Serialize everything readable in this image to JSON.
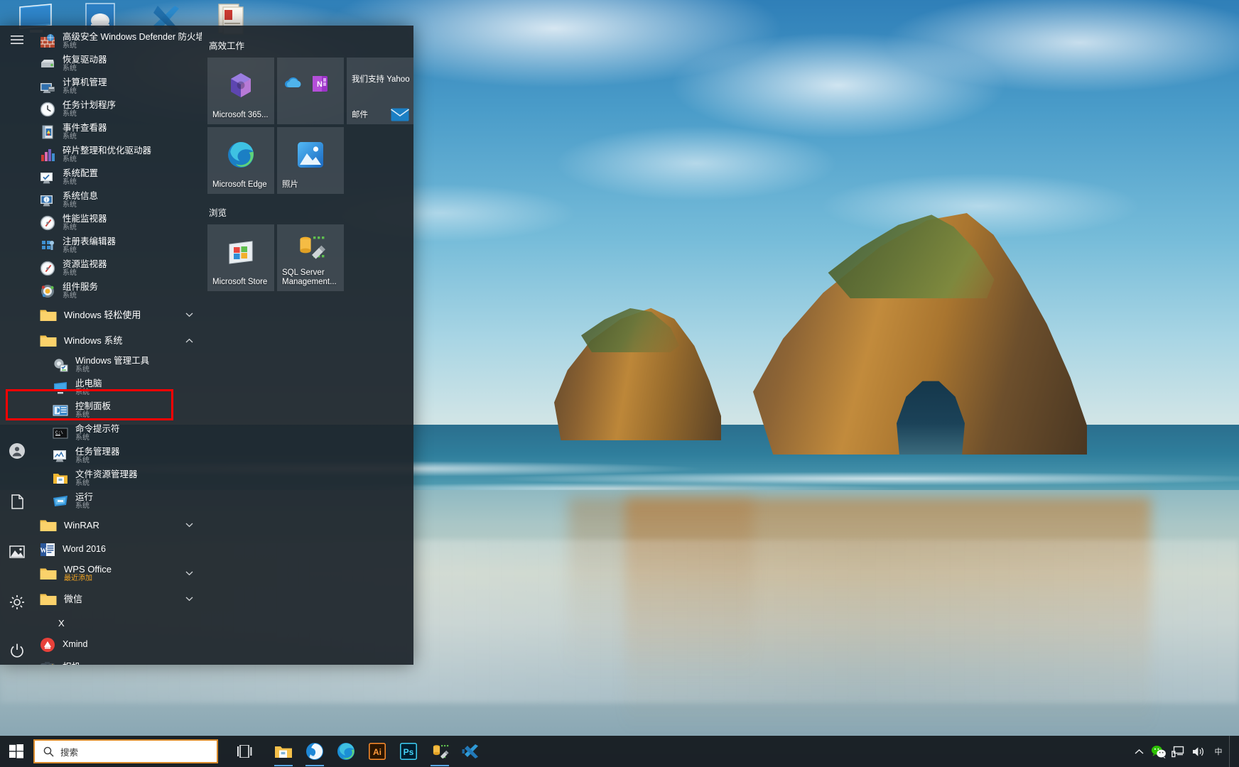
{
  "desktop": {
    "icons": [
      {
        "name": "this-pc",
        "label": ""
      },
      {
        "name": "axure",
        "label": ""
      },
      {
        "name": "vs-code",
        "label": ""
      },
      {
        "name": "pdf-doc",
        "label": ""
      }
    ]
  },
  "start_menu": {
    "rail": [
      {
        "name": "hamburger",
        "icon": "hamburger-icon",
        "label": ""
      },
      {
        "name": "user",
        "icon": "user-account-icon",
        "label": ""
      },
      {
        "name": "documents",
        "icon": "documents-icon",
        "label": ""
      },
      {
        "name": "pictures",
        "icon": "pictures-icon",
        "label": ""
      },
      {
        "name": "settings",
        "icon": "gear-icon",
        "label": ""
      },
      {
        "name": "power",
        "icon": "power-icon",
        "label": ""
      }
    ],
    "apps": [
      {
        "type": "app",
        "name": "高级安全 Windows Defender 防火墙",
        "sub": "系统",
        "icon": "firewall-icon"
      },
      {
        "type": "app",
        "name": "恢复驱动器",
        "sub": "系统",
        "icon": "recovery-drive-icon"
      },
      {
        "type": "app",
        "name": "计算机管理",
        "sub": "系统",
        "icon": "computer-management-icon"
      },
      {
        "type": "app",
        "name": "任务计划程序",
        "sub": "系统",
        "icon": "task-scheduler-icon"
      },
      {
        "type": "app",
        "name": "事件查看器",
        "sub": "系统",
        "icon": "event-viewer-icon"
      },
      {
        "type": "app",
        "name": "碎片整理和优化驱动器",
        "sub": "系统",
        "icon": "defrag-icon"
      },
      {
        "type": "app",
        "name": "系统配置",
        "sub": "系统",
        "icon": "msconfig-icon"
      },
      {
        "type": "app",
        "name": "系统信息",
        "sub": "系统",
        "icon": "system-info-icon"
      },
      {
        "type": "app",
        "name": "性能监视器",
        "sub": "系统",
        "icon": "performance-monitor-icon"
      },
      {
        "type": "app",
        "name": "注册表编辑器",
        "sub": "系统",
        "icon": "regedit-icon"
      },
      {
        "type": "app",
        "name": "资源监视器",
        "sub": "系统",
        "icon": "resource-monitor-icon"
      },
      {
        "type": "app",
        "name": "组件服务",
        "sub": "系统",
        "icon": "component-services-icon"
      },
      {
        "type": "folder",
        "name": "Windows 轻松使用",
        "expanded": false,
        "icon": "folder-icon"
      },
      {
        "type": "folder",
        "name": "Windows 系统",
        "expanded": true,
        "icon": "folder-icon"
      },
      {
        "type": "app",
        "indent": true,
        "name": "Windows 管理工具",
        "sub": "系统",
        "icon": "admin-tools-icon"
      },
      {
        "type": "app",
        "indent": true,
        "name": "此电脑",
        "sub": "系统",
        "icon": "this-pc-icon"
      },
      {
        "type": "app",
        "indent": true,
        "name": "控制面板",
        "sub": "系统",
        "icon": "control-panel-icon",
        "highlighted": true
      },
      {
        "type": "app",
        "indent": true,
        "name": "命令提示符",
        "sub": "系统",
        "icon": "cmd-icon"
      },
      {
        "type": "app",
        "indent": true,
        "name": "任务管理器",
        "sub": "系统",
        "icon": "task-manager-icon"
      },
      {
        "type": "app",
        "indent": true,
        "name": "文件资源管理器",
        "sub": "系统",
        "icon": "file-explorer-icon"
      },
      {
        "type": "app",
        "indent": true,
        "name": "运行",
        "sub": "系统",
        "icon": "run-icon"
      },
      {
        "type": "folder",
        "name": "WinRAR",
        "expanded": false,
        "icon": "folder-icon"
      },
      {
        "type": "app",
        "name": "Word 2016",
        "sub": "",
        "icon": "word-icon"
      },
      {
        "type": "folder",
        "name": "WPS Office",
        "sub": "最近添加",
        "expanded": false,
        "icon": "folder-icon",
        "sub_accent": true
      },
      {
        "type": "folder",
        "name": "微信",
        "expanded": false,
        "icon": "folder-icon"
      },
      {
        "type": "letter",
        "name": "X"
      },
      {
        "type": "app",
        "name": "Xmind",
        "sub": "",
        "icon": "xmind-icon"
      },
      {
        "type": "app",
        "name": "相机",
        "sub": "",
        "icon": "camera-icon"
      }
    ],
    "tile_groups": [
      {
        "title": "高效工作",
        "tiles": [
          {
            "label": "Microsoft 365...",
            "icon": "microsoft-365-icon",
            "size": "med"
          },
          {
            "label": "",
            "icon": "onedrive-onenote-icon",
            "size": "med"
          },
          {
            "label": "邮件",
            "icon": "mail-icon",
            "size": "med",
            "live": "我们支持 Yahoo"
          },
          {
            "label": "Microsoft Edge",
            "icon": "edge-icon",
            "size": "med"
          },
          {
            "label": "照片",
            "icon": "photos-icon",
            "size": "med"
          }
        ]
      },
      {
        "title": "浏览",
        "tiles": [
          {
            "label": "Microsoft Store",
            "icon": "microsoft-store-icon",
            "size": "med"
          },
          {
            "label": "SQL Server Management...",
            "icon": "sql-server-icon",
            "size": "med"
          }
        ]
      }
    ]
  },
  "taskbar": {
    "start_label": "",
    "search": {
      "placeholder": "搜索",
      "value": "",
      "icon": "search-icon"
    },
    "task_view": {
      "name": "task-view",
      "icon": "task-view-icon"
    },
    "buttons": [
      {
        "name": "file-explorer",
        "icon": "file-explorer-icon",
        "active": true
      },
      {
        "name": "wps-office",
        "icon": "wps-icon",
        "active": true
      },
      {
        "name": "microsoft-edge",
        "icon": "edge-icon",
        "active": false
      },
      {
        "name": "illustrator",
        "icon": "illustrator-icon",
        "active": false
      },
      {
        "name": "photoshop",
        "icon": "photoshop-icon",
        "active": false
      },
      {
        "name": "sql-server",
        "icon": "sql-server-icon",
        "active": true
      },
      {
        "name": "vs-code",
        "icon": "vs-code-icon",
        "active": false
      }
    ],
    "tray": [
      {
        "name": "show-hidden-icons",
        "icon": "chevron-up-icon"
      },
      {
        "name": "wechat",
        "icon": "wechat-icon"
      },
      {
        "name": "network",
        "icon": "network-icon"
      },
      {
        "name": "volume",
        "icon": "speaker-icon"
      },
      {
        "name": "ime",
        "icon": "ime-icon"
      }
    ]
  },
  "colors": {
    "highlight": "#ff0000",
    "search_border": "#d98a2b",
    "accent_orange": "#f5a623",
    "menu_bg": "#1f262d"
  }
}
